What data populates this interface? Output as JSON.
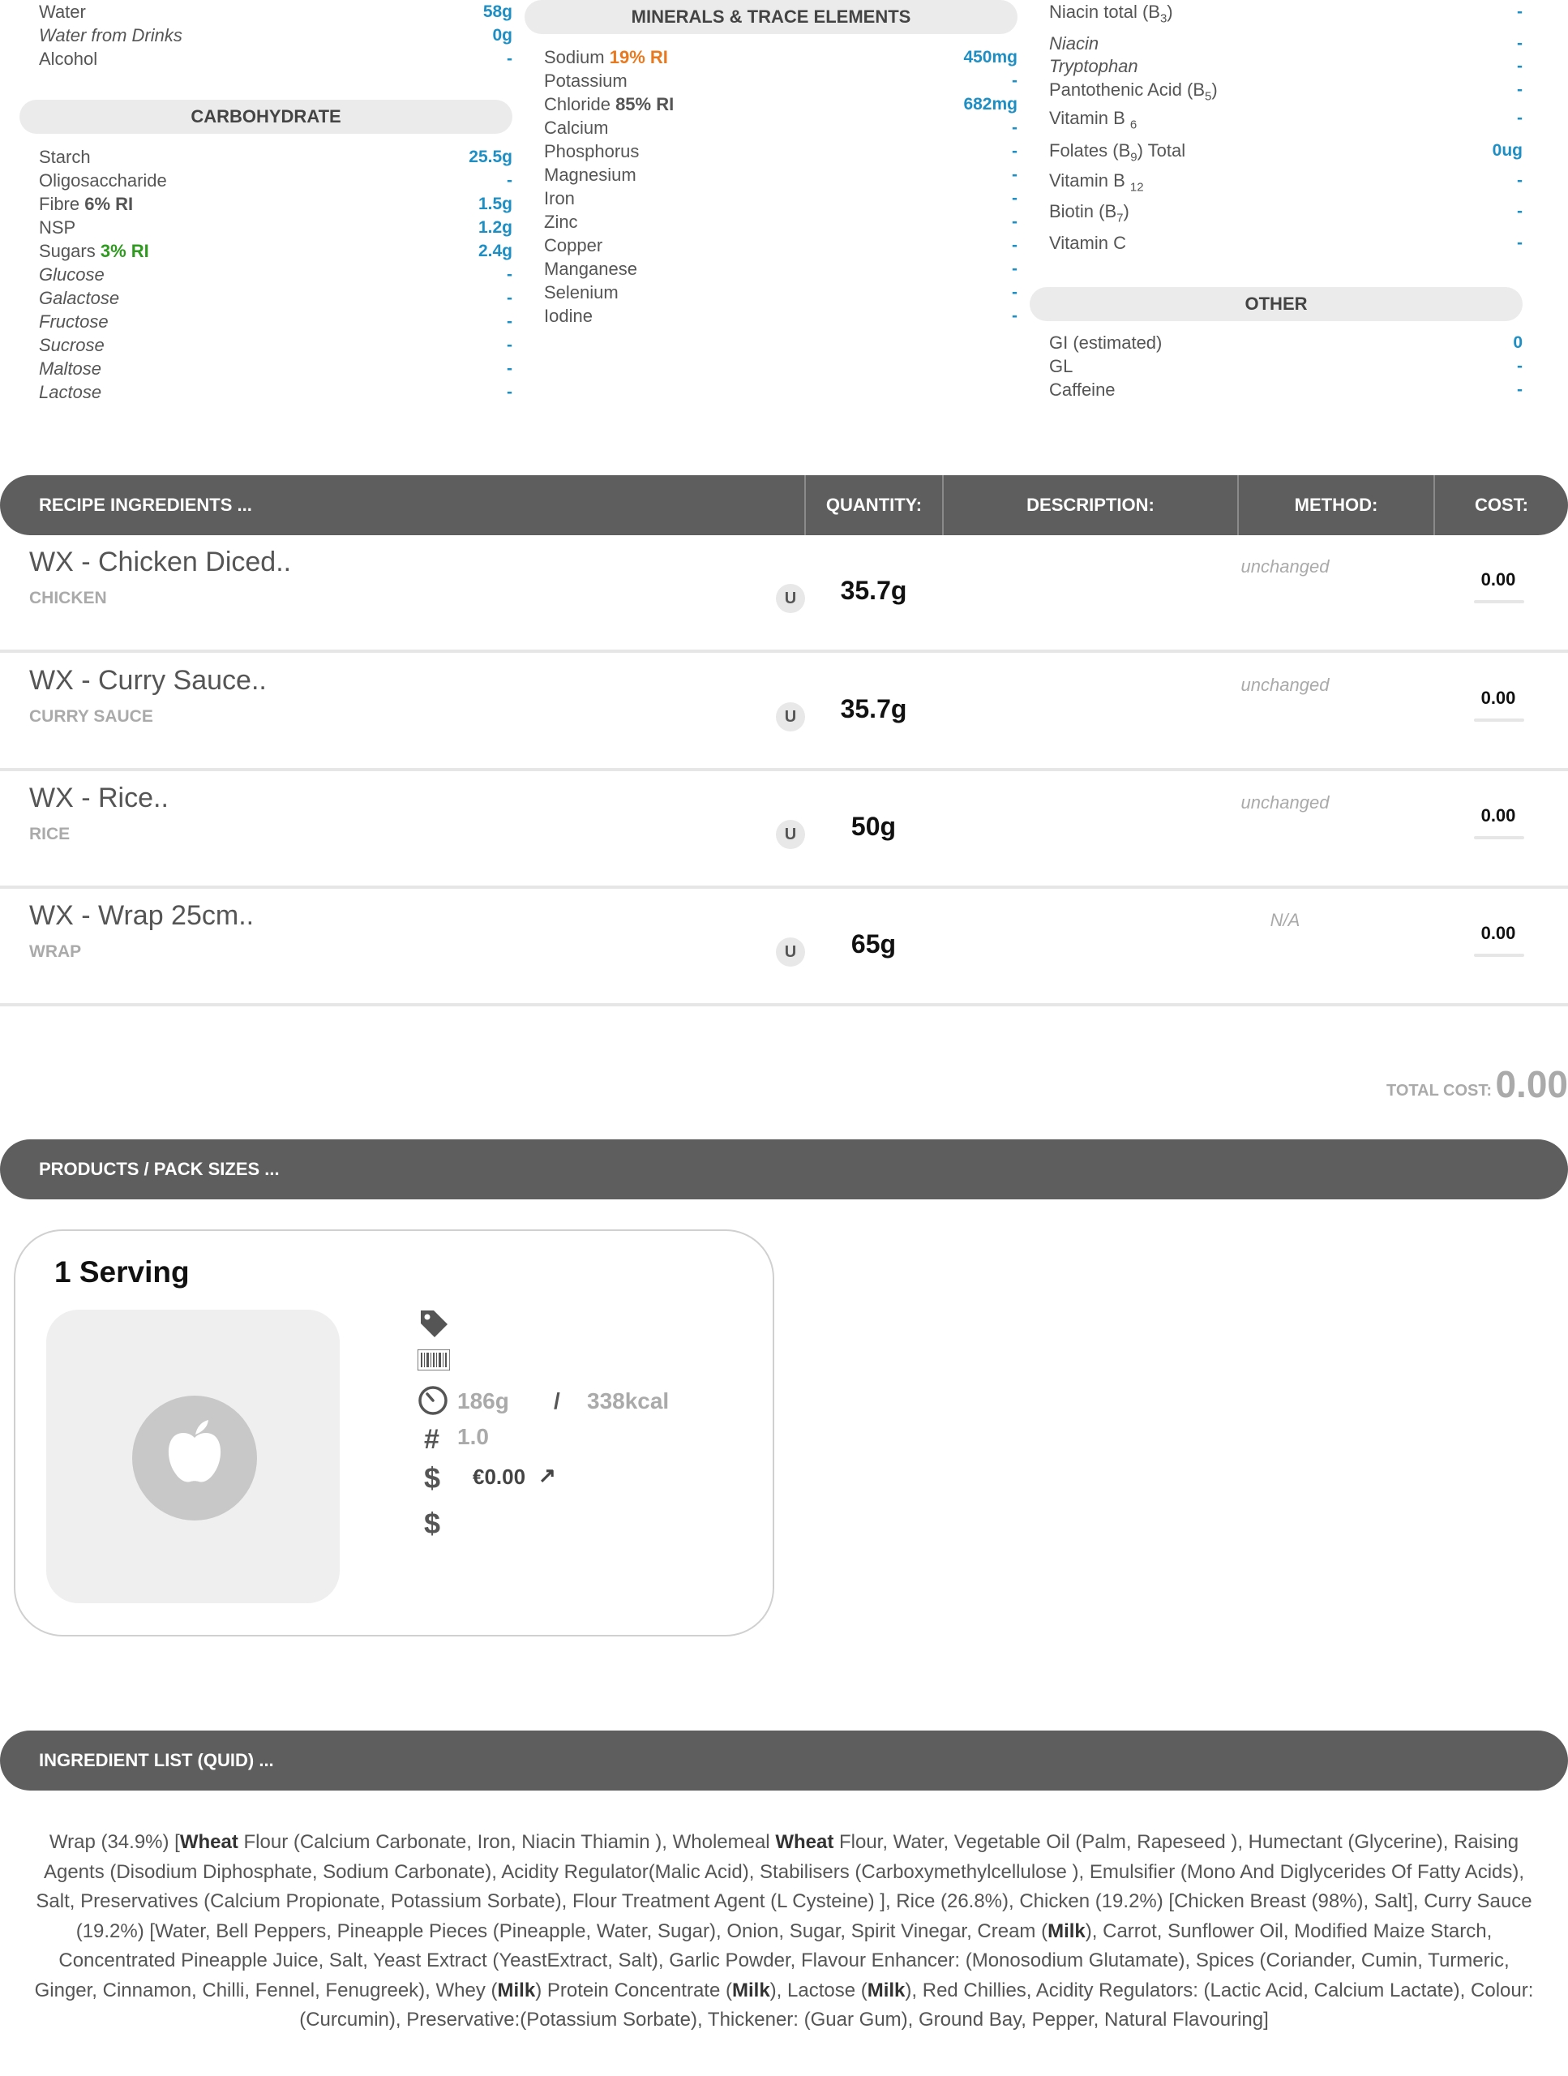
{
  "nutrients": {
    "water_section": [
      {
        "label": "Water",
        "value": "58g",
        "italic": false
      },
      {
        "label": "Water from Drinks",
        "value": "0g",
        "italic": true
      },
      {
        "label": "Alcohol",
        "value": "-",
        "italic": false
      }
    ],
    "carbohydrate_title": "CARBOHYDRATE",
    "carbohydrate": [
      {
        "label": "Starch",
        "value": "25.5g",
        "italic": false
      },
      {
        "label": "Oligosaccharide",
        "value": "-",
        "italic": false
      },
      {
        "label": "Fibre",
        "ri": "6% RI",
        "ri_color": "#555555",
        "value": "1.5g",
        "italic": false
      },
      {
        "label": "NSP",
        "value": "1.2g",
        "italic": false
      },
      {
        "label": "Sugars",
        "ri": "3% RI",
        "ri_color": "#2e9b1f",
        "value": "2.4g",
        "italic": false
      },
      {
        "label": "Glucose",
        "value": "-",
        "italic": true
      },
      {
        "label": "Galactose",
        "value": "-",
        "italic": true
      },
      {
        "label": "Fructose",
        "value": "-",
        "italic": true
      },
      {
        "label": "Sucrose",
        "value": "-",
        "italic": true
      },
      {
        "label": "Maltose",
        "value": "-",
        "italic": true
      },
      {
        "label": "Lactose",
        "value": "-",
        "italic": true
      }
    ],
    "minerals_title": "MINERALS & TRACE ELEMENTS",
    "minerals": [
      {
        "label": "Sodium",
        "ri": "19% RI",
        "ri_color": "#e8791e",
        "value": "450mg"
      },
      {
        "label": "Potassium",
        "value": "-"
      },
      {
        "label": "Chloride",
        "ri": "85% RI",
        "ri_color": "#555555",
        "value": "682mg"
      },
      {
        "label": "Calcium",
        "value": "-"
      },
      {
        "label": "Phosphorus",
        "value": "-"
      },
      {
        "label": "Magnesium",
        "value": "-"
      },
      {
        "label": "Iron",
        "value": "-"
      },
      {
        "label": "Zinc",
        "value": "-"
      },
      {
        "label": "Copper",
        "value": "-"
      },
      {
        "label": "Manganese",
        "value": "-"
      },
      {
        "label": "Selenium",
        "value": "-"
      },
      {
        "label": "Iodine",
        "value": "-"
      }
    ],
    "vitamins": [
      {
        "label": "Niacin total (B",
        "sub": "3",
        "tail": ")",
        "value": "-",
        "italic": false
      },
      {
        "label": "Niacin",
        "value": "-",
        "italic": true
      },
      {
        "label": "Tryptophan",
        "value": "-",
        "italic": true
      },
      {
        "label": "Pantothenic Acid (B",
        "sub": "5",
        "tail": ")",
        "value": "-",
        "italic": false
      },
      {
        "label": "Vitamin B ",
        "sub": "6",
        "tail": "",
        "value": "-",
        "italic": false
      },
      {
        "label": "Folates (B",
        "sub": "9",
        "tail": ") Total",
        "value": "0ug",
        "italic": false
      },
      {
        "label": "Vitamin B ",
        "sub": "12",
        "tail": "",
        "value": "-",
        "italic": false
      },
      {
        "label": "Biotin (B",
        "sub": "7",
        "tail": ")",
        "value": "-",
        "italic": false
      },
      {
        "label": "Vitamin C",
        "value": "-",
        "italic": false
      }
    ],
    "other_title": "OTHER",
    "other": [
      {
        "label": "GI (estimated)",
        "value": "0"
      },
      {
        "label": "GL",
        "value": "-"
      },
      {
        "label": "Caffeine",
        "value": "-"
      }
    ]
  },
  "recipe": {
    "header": "RECIPE INGREDIENTS ...",
    "columns": {
      "quantity": "QUANTITY:",
      "description": "DESCRIPTION:",
      "method": "METHOD:",
      "cost": "COST:"
    },
    "rows": [
      {
        "name": "WX - Chicken Diced..",
        "category": "CHICKEN",
        "unit": "U",
        "quantity": "35.7g",
        "method": "unchanged",
        "cost": "0.00"
      },
      {
        "name": "WX - Curry Sauce..",
        "category": "CURRY SAUCE",
        "unit": "U",
        "quantity": "35.7g",
        "method": "unchanged",
        "cost": "0.00"
      },
      {
        "name": "WX - Rice..",
        "category": "RICE",
        "unit": "U",
        "quantity": "50g",
        "method": "unchanged",
        "cost": "0.00"
      },
      {
        "name": "WX - Wrap 25cm..",
        "category": "WRAP",
        "unit": "U",
        "quantity": "65g",
        "method": "N/A",
        "cost": "0.00"
      }
    ],
    "total_label": "TOTAL COST:",
    "total_value": "0.00"
  },
  "products": {
    "header": "PRODUCTS / PACK SIZES ...",
    "card": {
      "title": "1 Serving",
      "weight": "186g",
      "separator": "/",
      "energy": "338kcal",
      "hash_symbol": "#",
      "count": "1.0",
      "dollar_symbol": "$",
      "price": "€0.00",
      "trend_arrow": "↗"
    }
  },
  "quid": {
    "header": "INGREDIENT LIST (QUID) ...",
    "segments": [
      {
        "t": "Wrap (34.9%) [",
        "b": false
      },
      {
        "t": "Wheat",
        "b": true
      },
      {
        "t": " Flour (Calcium Carbonate, Iron, Niacin Thiamin ), Wholemeal ",
        "b": false
      },
      {
        "t": "Wheat",
        "b": true
      },
      {
        "t": " Flour, Water, Vegetable Oil (Palm, Rapeseed ), Humectant (Glycerine), Raising Agents (Disodium Diphosphate, Sodium Carbonate), Acidity Regulator(Malic Acid), Stabilisers (Carboxymethylcellulose ), Emulsifier (Mono And Diglycerides Of Fatty Acids), Salt, Preservatives (Calcium Propionate, Potassium Sorbate), Flour Treatment Agent (L Cysteine) ], Rice (26.8%), Chicken (19.2%) [Chicken Breast (98%), Salt], Curry Sauce (19.2%) [Water, Bell Peppers, Pineapple Pieces (Pineapple, Water, Sugar), Onion, Sugar, Spirit Vinegar, Cream (",
        "b": false
      },
      {
        "t": "Milk",
        "b": true
      },
      {
        "t": "), Carrot, Sunflower Oil, Modified Maize Starch, Concentrated Pineapple Juice, Salt, Yeast Extract (YeastExtract, Salt), Garlic Powder, Flavour Enhancer: (Monosodium Glutamate), Spices (Coriander, Cumin, Turmeric, Ginger, Cinnamon, Chilli, Fennel, Fenugreek), Whey (",
        "b": false
      },
      {
        "t": "Milk",
        "b": true
      },
      {
        "t": ") Protein Concentrate (",
        "b": false
      },
      {
        "t": "Milk",
        "b": true
      },
      {
        "t": "), Lactose (",
        "b": false
      },
      {
        "t": "Milk",
        "b": true
      },
      {
        "t": "), Red Chillies, Acidity Regulators: (Lactic Acid, Calcium Lactate), Colour: (Curcumin), Preservative:(Potassium Sorbate), Thickener: (Guar Gum), Ground Bay, Pepper, Natural Flavouring]",
        "b": false
      }
    ]
  },
  "icons": [
    "tag-icon",
    "barcode-icon",
    "gauge-icon",
    "apple-icon",
    "trend-arrow-icon"
  ]
}
